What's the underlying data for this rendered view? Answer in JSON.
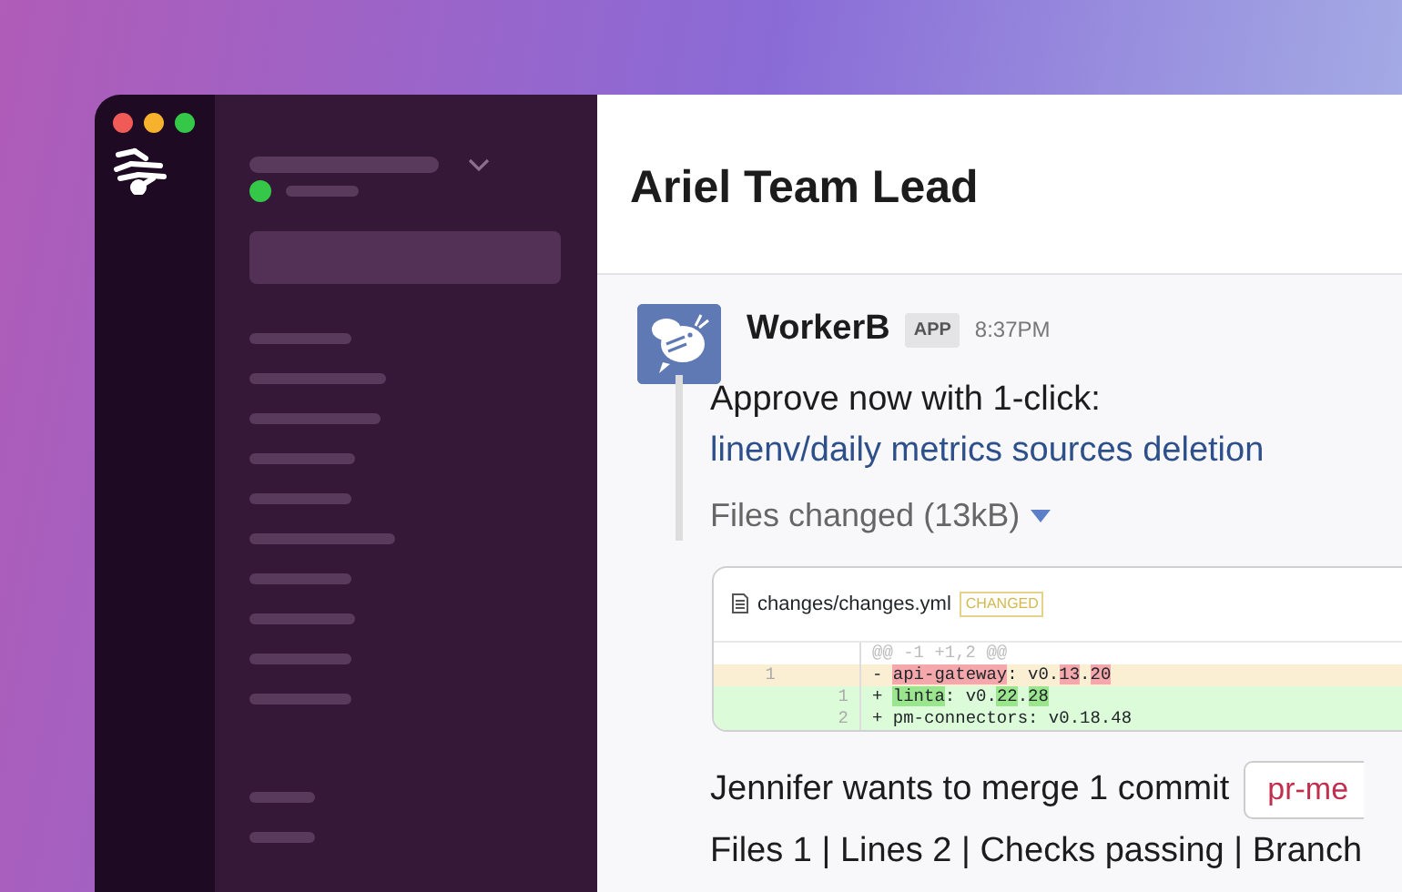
{
  "window": {
    "title": "Ariel Team Lead"
  },
  "message": {
    "sender": "WorkerB",
    "badge": "APP",
    "time": "8:37PM",
    "intro": "Approve now with 1-click:",
    "link": "linenv/daily metrics sources deletion",
    "files_toggle": {
      "label": "Files changed (13kB)",
      "expanded": true
    },
    "diff": {
      "file": "changes/changes.yml",
      "status": "CHANGED",
      "lines": [
        {
          "kind": "hunk",
          "parts": [
            {
              "text": "@@ -1 +1,2 @@",
              "hl": false
            }
          ]
        },
        {
          "kind": "del",
          "old": "1",
          "sign": "-",
          "parts": [
            {
              "text": "api-gateway",
              "hl": true
            },
            {
              "text": ": v0.",
              "hl": false
            },
            {
              "text": "13",
              "hl": true
            },
            {
              "text": ".",
              "hl": false
            },
            {
              "text": "20",
              "hl": true
            }
          ]
        },
        {
          "kind": "add",
          "new": "1",
          "sign": "+",
          "parts": [
            {
              "text": "linta",
              "hl": true
            },
            {
              "text": ": v0.",
              "hl": false
            },
            {
              "text": "22",
              "hl": true
            },
            {
              "text": ".",
              "hl": false
            },
            {
              "text": "28",
              "hl": true
            }
          ]
        },
        {
          "kind": "add",
          "new": "2",
          "sign": "+",
          "parts": [
            {
              "text": "pm-connectors: v0.18.48",
              "hl": false
            }
          ]
        }
      ]
    },
    "merge_text": "Jennifer wants to merge 1 commit",
    "branch": "pr-me",
    "summary": "Files 1 | Lines 2 | Checks passing | Branch"
  }
}
